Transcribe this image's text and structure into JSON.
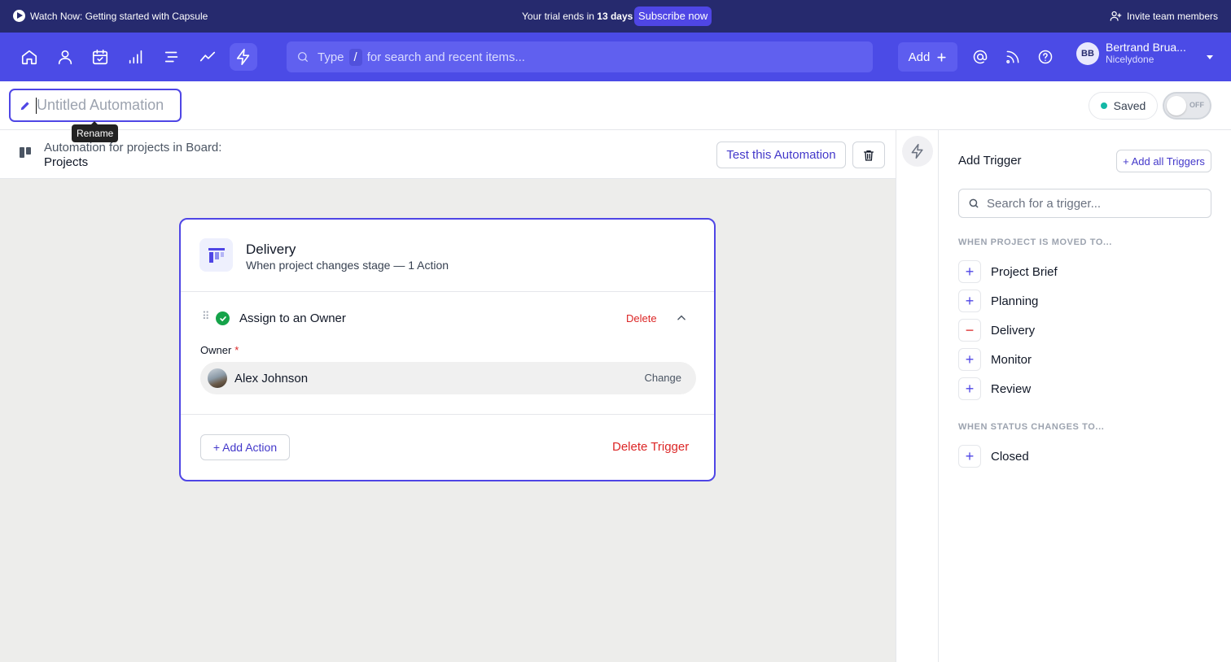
{
  "banner": {
    "watch": "Watch Now: Getting started with Capsule",
    "trial_prefix": "Your trial ends in",
    "trial_days": "13 days",
    "subscribe": "Subscribe now",
    "invite": "Invite team members"
  },
  "nav": {
    "icons": [
      "home-icon",
      "person-icon",
      "calendar-check-icon",
      "bar-chart-icon",
      "pipeline-icon",
      "trend-line-icon",
      "lightning-icon"
    ],
    "active_icon": "lightning-icon",
    "search_prefix": "Type",
    "search_key": "/",
    "search_suffix": "for search and recent items...",
    "add_label": "Add",
    "user_initials": "BB",
    "user_name": "Bertrand Brua...",
    "user_org": "Nicelydone"
  },
  "header": {
    "title_placeholder": "Untitled Automation",
    "tooltip": "Rename",
    "saved": "Saved",
    "toggle": "OFF"
  },
  "subheader": {
    "line1": "Automation for projects in Board:",
    "board": "Projects",
    "test_button": "Test this Automation"
  },
  "card": {
    "stage_title": "Delivery",
    "stage_subtitle": "When project changes stage — 1 Action",
    "action_title": "Assign to an Owner",
    "action_delete": "Delete",
    "owner_label": "Owner",
    "owner_required": "*",
    "owner_name": "Alex Johnson",
    "owner_change": "Change",
    "add_action": "+ Add Action",
    "delete_trigger": "Delete Trigger"
  },
  "panel": {
    "title": "Add Trigger",
    "add_all": "+ Add all Triggers",
    "search_placeholder": "Search for a trigger...",
    "section1": "WHEN PROJECT IS MOVED TO...",
    "stages": [
      {
        "label": "Project Brief",
        "state": "+"
      },
      {
        "label": "Planning",
        "state": "+"
      },
      {
        "label": "Delivery",
        "state": "−"
      },
      {
        "label": "Monitor",
        "state": "+"
      },
      {
        "label": "Review",
        "state": "+"
      }
    ],
    "section2": "WHEN STATUS CHANGES TO...",
    "statuses": [
      {
        "label": "Closed",
        "state": "+"
      }
    ]
  },
  "colors": {
    "banner": "#262a6e",
    "nav": "#4b4be6",
    "accent": "#4f46e5",
    "danger": "#dc2626",
    "success": "#16a34a"
  }
}
